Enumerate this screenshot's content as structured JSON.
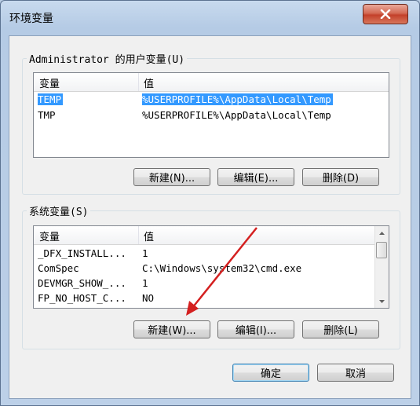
{
  "window": {
    "title": "环境变量"
  },
  "user_vars": {
    "label": "Administrator 的用户变量(U)",
    "columns": [
      "变量",
      "值"
    ],
    "rows": [
      {
        "name": "TEMP",
        "value": "%USERPROFILE%\\AppData\\Local\\Temp",
        "selected": true
      },
      {
        "name": "TMP",
        "value": "%USERPROFILE%\\AppData\\Local\\Temp",
        "selected": false
      }
    ],
    "buttons": {
      "new": "新建(N)...",
      "edit": "编辑(E)...",
      "delete": "删除(D)"
    }
  },
  "system_vars": {
    "label": "系统变量(S)",
    "columns": [
      "变量",
      "值"
    ],
    "rows": [
      {
        "name": "_DFX_INSTALL...",
        "value": "1"
      },
      {
        "name": "ComSpec",
        "value": "C:\\Windows\\system32\\cmd.exe"
      },
      {
        "name": "DEVMGR_SHOW_...",
        "value": "1"
      },
      {
        "name": "FP_NO_HOST_C...",
        "value": "NO"
      }
    ],
    "buttons": {
      "new": "新建(W)...",
      "edit": "编辑(I)...",
      "delete": "删除(L)"
    }
  },
  "dialog_buttons": {
    "ok": "确定",
    "cancel": "取消"
  },
  "colors": {
    "selection": "#3399ff",
    "annotation_arrow": "#d42020",
    "close_button": "#c3402a"
  },
  "icons": {
    "close": "close-x-icon",
    "scroll_up": "chevron-up-icon",
    "scroll_down": "chevron-down-icon"
  }
}
